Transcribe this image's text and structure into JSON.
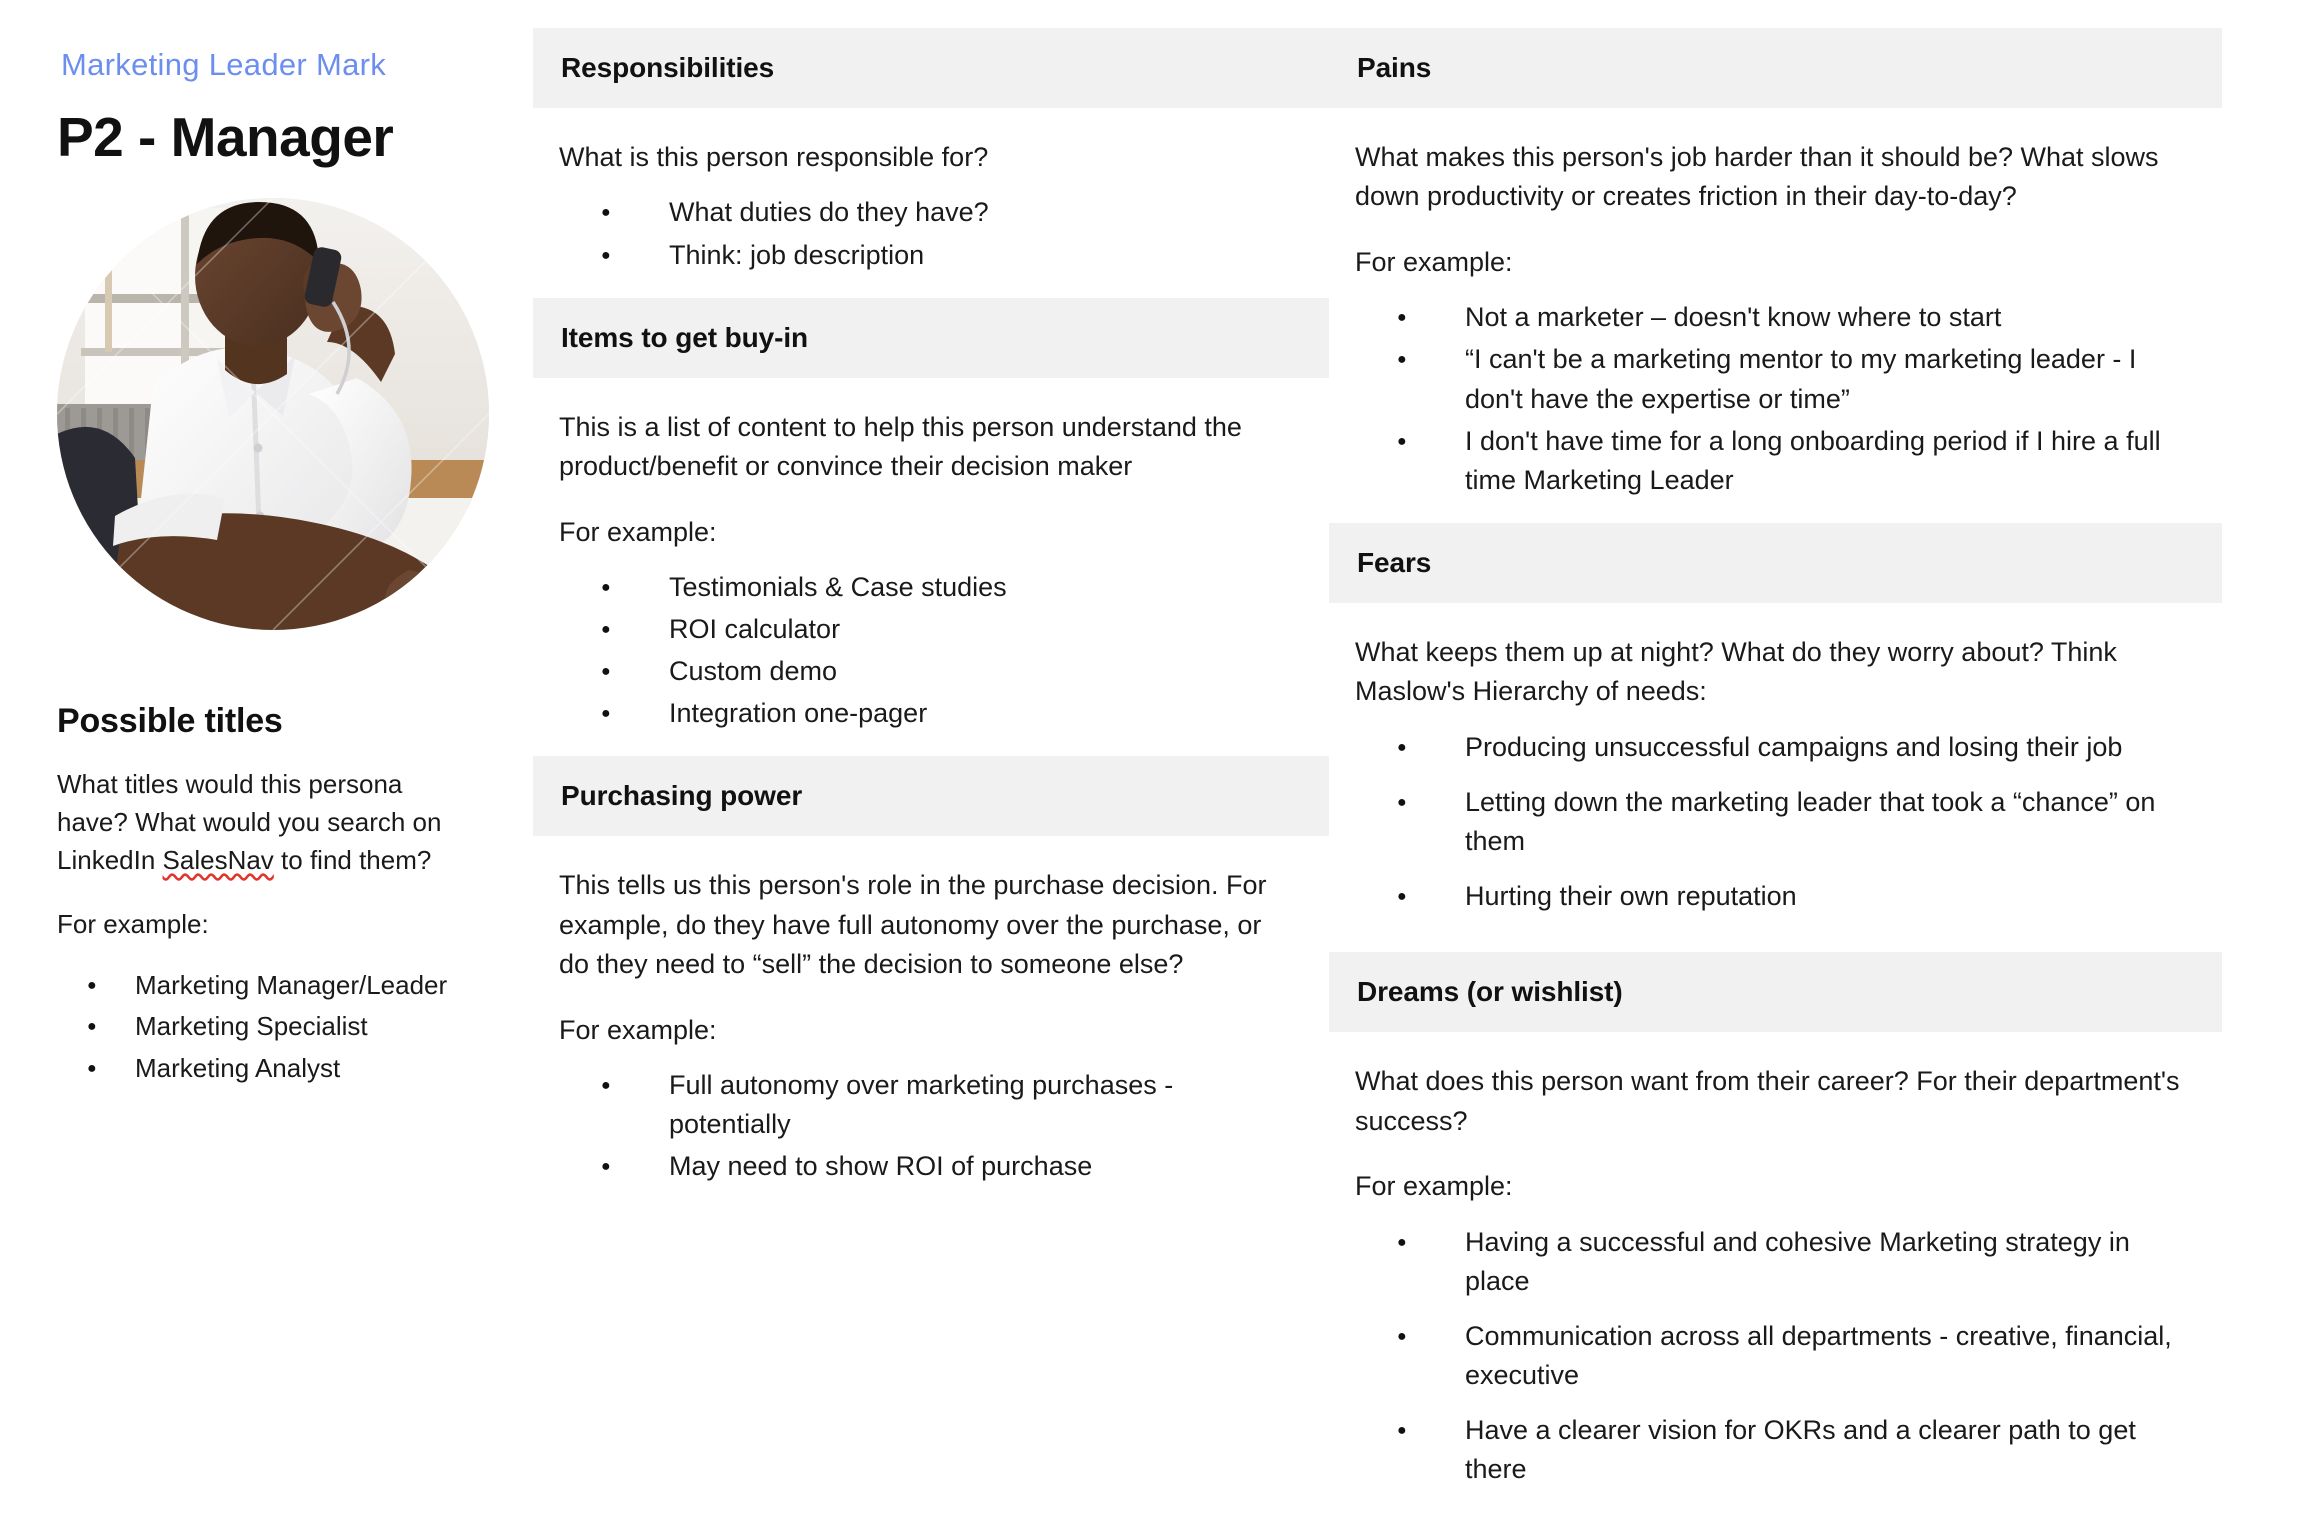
{
  "persona": {
    "kicker": "Marketing Leader Mark",
    "title": "P2 - Manager",
    "kicker_color": "#6c8fef",
    "portrait_alt": "man-on-phone-photo"
  },
  "possible_titles": {
    "heading": "Possible titles",
    "body_part1": "What titles would this persona have? What would you search on LinkedIn ",
    "body_spell": "SalesNav",
    "body_part2": " to find them?",
    "for_example": "For example:",
    "items": [
      "Marketing Manager/Leader",
      "Marketing Specialist",
      "Marketing Analyst"
    ]
  },
  "middle": {
    "responsibilities": {
      "heading": "Responsibilities",
      "intro": "What is this person responsible for?",
      "items": [
        "What duties do they have?",
        "Think: job description"
      ]
    },
    "buy_in": {
      "heading": "Items to get buy-in",
      "intro": "This is a list of content to help this person understand the product/benefit or convince their decision maker",
      "for_example": "For example:",
      "items": [
        "Testimonials & Case studies",
        "ROI calculator",
        "Custom demo",
        "Integration one-pager"
      ]
    },
    "purchasing_power": {
      "heading": "Purchasing power",
      "intro": "This tells us this person's role in the purchase decision. For example, do they have full autonomy over the purchase, or do they need to “sell” the decision to someone else?",
      "for_example": "For example:",
      "items": [
        "Full autonomy over marketing purchases - potentially",
        "May need to show ROI of purchase"
      ]
    }
  },
  "right": {
    "pains": {
      "heading": "Pains",
      "intro": "What makes this person's job harder than it should be? What slows down productivity or creates friction in their day-to-day?",
      "for_example": "For example:",
      "items": [
        "Not a marketer – doesn't know where to start",
        "“I can't be a marketing mentor to my marketing leader - I don't have the expertise or time”",
        "I don't have time for a long onboarding period if I hire a full time Marketing Leader"
      ]
    },
    "fears": {
      "heading": "Fears",
      "intro": "What keeps them up at night? What do they worry about? Think Maslow's Hierarchy of needs:",
      "items": [
        "Producing unsuccessful campaigns and losing their job",
        "Letting down the marketing leader that took a “chance” on them",
        "Hurting their own reputation"
      ]
    },
    "dreams": {
      "heading": "Dreams (or wishlist)",
      "intro": "What does this person want from their career? For their department's success?",
      "for_example": "For example:",
      "items": [
        "Having a successful and cohesive Marketing strategy in place",
        "Communication across all departments - creative, financial, executive",
        "Have a clearer vision for OKRs and a clearer path to get there"
      ]
    }
  },
  "colors": {
    "band_bg": "#f1f1f1",
    "text": "#1a1a1a",
    "accent": "#6c8fef",
    "spellcheck_underline": "#e2342b"
  }
}
